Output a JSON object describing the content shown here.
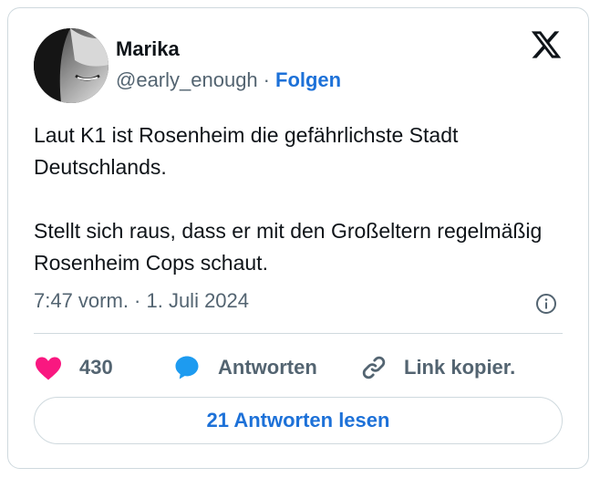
{
  "author": {
    "name": "Marika",
    "handle": "@early_enough",
    "separator": "·",
    "follow_label": "Folgen"
  },
  "tweet": {
    "paragraphs": [
      "Laut K1 ist Rosenheim die gefährlichste Stadt Deutschlands.",
      "Stellt sich raus, dass er mit den Großeltern regelmäßig Rosenheim Cops schaut."
    ],
    "timestamp": "7:47 vorm. · 1. Juli 2024"
  },
  "actions": {
    "like_count": "430",
    "reply_label": "Antworten",
    "copy_link_label": "Link kopier."
  },
  "read_replies_label": "21 Antworten lesen",
  "icons": {
    "logo": "x-logo-icon",
    "info": "info-icon",
    "like": "heart-icon",
    "reply": "speech-bubble-icon",
    "link": "link-icon"
  },
  "colors": {
    "accent": "#1d71d8",
    "heart": "#f91880",
    "reply_bubble": "#1d9bf0",
    "secondary_text": "#536471",
    "border": "#cfd9de"
  }
}
